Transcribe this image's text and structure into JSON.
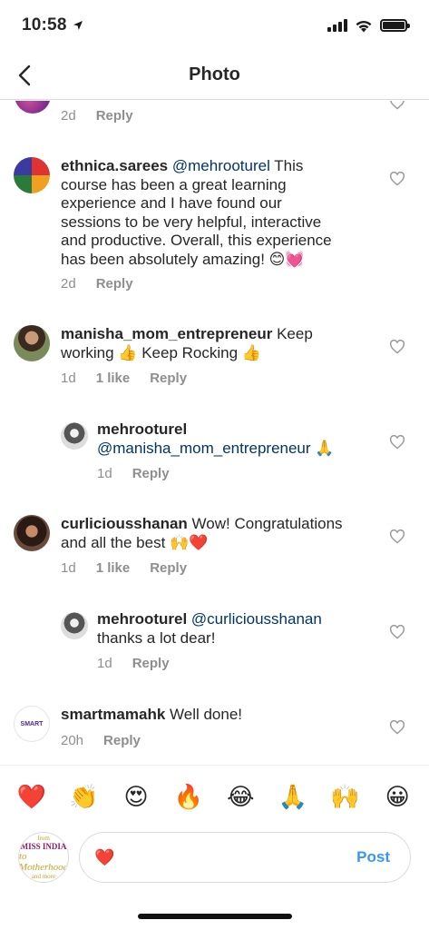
{
  "status_bar": {
    "time": "10:58"
  },
  "nav": {
    "title": "Photo"
  },
  "comments": [
    {
      "id": "partial",
      "time": "2d",
      "reply_label": "Reply"
    },
    {
      "id": "ethnica",
      "username": "ethnica.sarees",
      "mention": "@mehrooturel",
      "line1_rest": " This",
      "lines": [
        "course has been a great learning",
        "experience and I have found our",
        "sessions to be very helpful, interactive",
        "and productive. Overall, this experience",
        "has been absolutely amazing! 😊💓"
      ],
      "time": "2d",
      "reply_label": "Reply"
    },
    {
      "id": "manisha",
      "username": "manisha_mom_entrepreneur",
      "line1_rest": " Keep",
      "line2": "working 👍 Keep Rocking 👍",
      "time": "1d",
      "likes": "1 like",
      "reply_label": "Reply"
    },
    {
      "id": "mehroo1",
      "username": "mehrooturel",
      "mention": "@manisha_mom_entrepreneur",
      "emoji": "🙏",
      "time": "1d",
      "reply_label": "Reply"
    },
    {
      "id": "curly",
      "username": "curliciousshanan",
      "line1_rest": " Wow! Congratulations",
      "line2": "and all the best 🙌❤️",
      "time": "1d",
      "likes": "1 like",
      "reply_label": "Reply"
    },
    {
      "id": "mehroo2",
      "username": "mehrooturel",
      "mention": "@curliciousshanan",
      "line2": "thanks a lot dear!",
      "time": "1d",
      "reply_label": "Reply"
    },
    {
      "id": "smart",
      "username": "smartmamahk",
      "line1_rest": " Well done!",
      "avatar_text": "SMART",
      "time": "20h",
      "reply_label": "Reply"
    }
  ],
  "reactions": [
    "❤️",
    "👏",
    "😍",
    "🔥",
    "😂",
    "🙏",
    "🙌",
    "😀"
  ],
  "composer": {
    "avatar_lines": [
      "from",
      "MISS INDIA",
      "to Motherhood",
      "and more"
    ],
    "input_value": "❤️",
    "post_label": "Post"
  },
  "colors": {
    "accent_blue": "#3897f0",
    "mention_blue": "#003569",
    "meta_gray": "#8e8e8e"
  }
}
